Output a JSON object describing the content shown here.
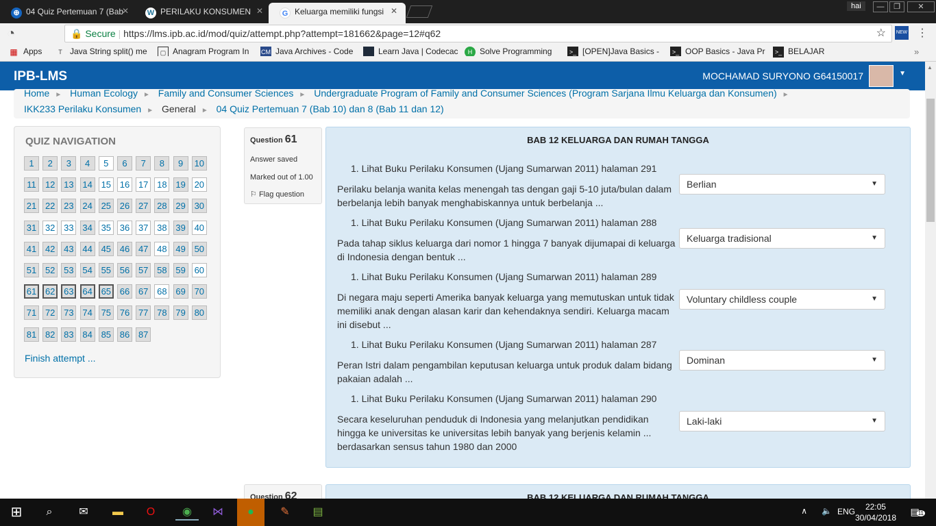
{
  "browser": {
    "tabs": [
      {
        "title": "04 Quiz Pertemuan 7 (Bab",
        "icon": "moodle-icon"
      },
      {
        "title": "PERILAKU KONSUMEN",
        "icon": "wordpress-icon"
      },
      {
        "title": "Keluarga memiliki fungsi",
        "icon": "google-icon"
      }
    ],
    "profile": "hai",
    "secure_label": "Secure",
    "url": "https://lms.ipb.ac.id/mod/quiz/attempt.php?attempt=181662&page=12#q62",
    "bookmarks": [
      "Apps",
      "Java String split() me",
      "Anagram Program In",
      "Java Archives - Code",
      "Learn Java | Codecac",
      "Solve Programming",
      "[OPEN]Java Basics -",
      "OOP Basics - Java Pr",
      "BELAJAR"
    ]
  },
  "site": {
    "brand": "IPB-LMS",
    "user": "MOCHAMAD SURYONO G64150017"
  },
  "breadcrumb": [
    "Home",
    "Human Ecology",
    "Family and Consumer Sciences",
    "Undergraduate Program of Family and Consumer Sciences (Program Sarjana Ilmu Keluarga dan Konsumen)",
    "IKK233 Perilaku Konsumen",
    "General",
    "04 Quiz Pertemuan 7 (Bab 10) dan 8 (Bab 11 dan 12)"
  ],
  "quiz_nav": {
    "title": "QUIZ NAVIGATION",
    "unanswered": [
      5,
      15,
      16,
      17,
      18,
      20,
      32,
      33,
      35,
      36,
      37,
      38,
      40,
      48,
      60,
      68
    ],
    "current": [
      61,
      62,
      63,
      64,
      65
    ],
    "total": 87,
    "finish": "Finish attempt ..."
  },
  "question61": {
    "label": "Question",
    "number": "61",
    "state": "Answer saved",
    "marks": "Marked out of 1.00",
    "flag": "Flag question",
    "title": "BAB 12 KELUARGA  DAN RUMAH TANGGA",
    "items": [
      {
        "ref": "1. Lihat Buku Perilaku Konsumen (Ujang Sumarwan 2011) halaman 291",
        "text": "Perilaku belanja wanita kelas menengah tas dengan gaji 5-10 juta/bulan dalam berbelanja lebih banyak menghabiskannya untuk berbelanja ...",
        "answer": "Berlian"
      },
      {
        "ref": "1. Lihat Buku Perilaku Konsumen (Ujang Sumarwan 2011) halaman 288",
        "text": "Pada tahap siklus keluarga dari nomor 1 hingga 7 banyak dijumapai di keluarga di Indonesia dengan bentuk ...",
        "answer": "Keluarga tradisional"
      },
      {
        "ref": "1. Lihat Buku Perilaku Konsumen (Ujang Sumarwan 2011) halaman 289",
        "text": "Di negara maju seperti Amerika banyak keluarga yang memutuskan untuk tidak memiliki anak dengan alasan karir dan kehendaknya sendiri. Keluarga macam ini disebut ...",
        "answer": "Voluntary childless couple"
      },
      {
        "ref": "1. Lihat Buku Perilaku Konsumen (Ujang Sumarwan 2011) halaman 287",
        "text": "Peran Istri dalam pengambilan keputusan keluarga untuk produk dalam bidang pakaian adalah ...",
        "answer": "Dominan"
      },
      {
        "ref": "1. Lihat Buku Perilaku Konsumen (Ujang Sumarwan 2011) halaman 290",
        "text": "Secara keseluruhan penduduk di Indonesia yang melanjutkan pendidikan hingga ke universitas ke universitas  lebih banyak yang berjenis kelamin ... berdasarkan sensus tahun 1980 dan 2000",
        "answer": "Laki-laki"
      }
    ]
  },
  "question62": {
    "label": "Question",
    "number": "62",
    "title": "BAB 12 KELUARGA  DAN RUMAH TANGGA"
  },
  "taskbar": {
    "lang": "ENG",
    "time": "22:05",
    "date": "30/04/2018",
    "notifications": "11"
  }
}
